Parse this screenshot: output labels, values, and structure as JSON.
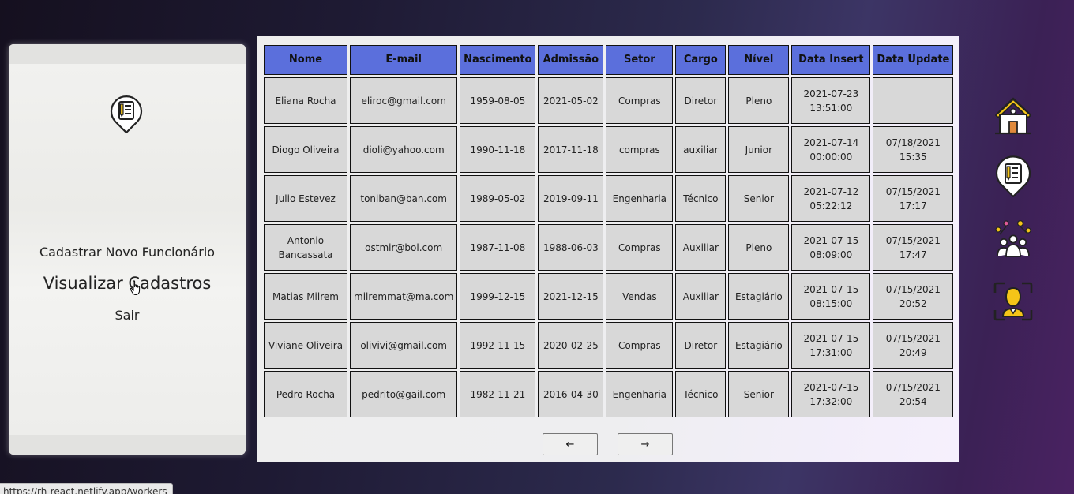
{
  "menu": {
    "new_label": "Cadastrar Novo Funcionário",
    "view_label": "Visualizar Cadastros",
    "exit_label": "Sair"
  },
  "table": {
    "headers": [
      "Nome",
      "E-mail",
      "Nascimento",
      "Admissão",
      "Setor",
      "Cargo",
      "Nível",
      "Data Insert",
      "Data Update"
    ],
    "rows": [
      [
        "Eliana Rocha",
        "eliroc@gmail.com",
        "1959-08-05",
        "2021-05-02",
        "Compras",
        "Diretor",
        "Pleno",
        "2021-07-23 13:51:00",
        ""
      ],
      [
        "Diogo Oliveira",
        "dioli@yahoo.com",
        "1990-11-18",
        "2017-11-18",
        "compras",
        "auxiliar",
        "Junior",
        "2021-07-14 00:00:00",
        "07/18/2021 15:35"
      ],
      [
        "Julio Estevez",
        "toniban@ban.com",
        "1989-05-02",
        "2019-09-11",
        "Engenharia",
        "Técnico",
        "Senior",
        "2021-07-12 05:22:12",
        "07/15/2021 17:17"
      ],
      [
        "Antonio Bancassata",
        "ostmir@bol.com",
        "1987-11-08",
        "1988-06-03",
        "Compras",
        "Auxiliar",
        "Pleno",
        "2021-07-15 08:09:00",
        "07/15/2021 17:47"
      ],
      [
        "Matias Milrem",
        "milremmat@ma.com",
        "1999-12-15",
        "2021-12-15",
        "Vendas",
        "Auxiliar",
        "Estagiário",
        "2021-07-15 08:15:00",
        "07/15/2021 20:52"
      ],
      [
        "Viviane Oliveira",
        "olivivi@gmail.com",
        "1992-11-15",
        "2020-02-25",
        "Compras",
        "Diretor",
        "Estagiário",
        "2021-07-15 17:31:00",
        "07/15/2021 20:49"
      ],
      [
        "Pedro Rocha",
        "pedrito@gail.com",
        "1982-11-21",
        "2016-04-30",
        "Engenharia",
        "Técnico",
        "Senior",
        "2021-07-15 17:32:00",
        "07/15/2021 20:54"
      ]
    ]
  },
  "pager": {
    "prev_label": "←",
    "next_label": "→"
  },
  "nav": {
    "icons": [
      "home-icon",
      "register-icon",
      "team-icon",
      "profile-icon"
    ]
  },
  "status": {
    "url": "https://rh-react.netlify.app/workers"
  },
  "colors": {
    "header_bg": "#5b6fdc",
    "cell_bg": "#d8d8d8",
    "accent_yellow": "#f5c518"
  }
}
